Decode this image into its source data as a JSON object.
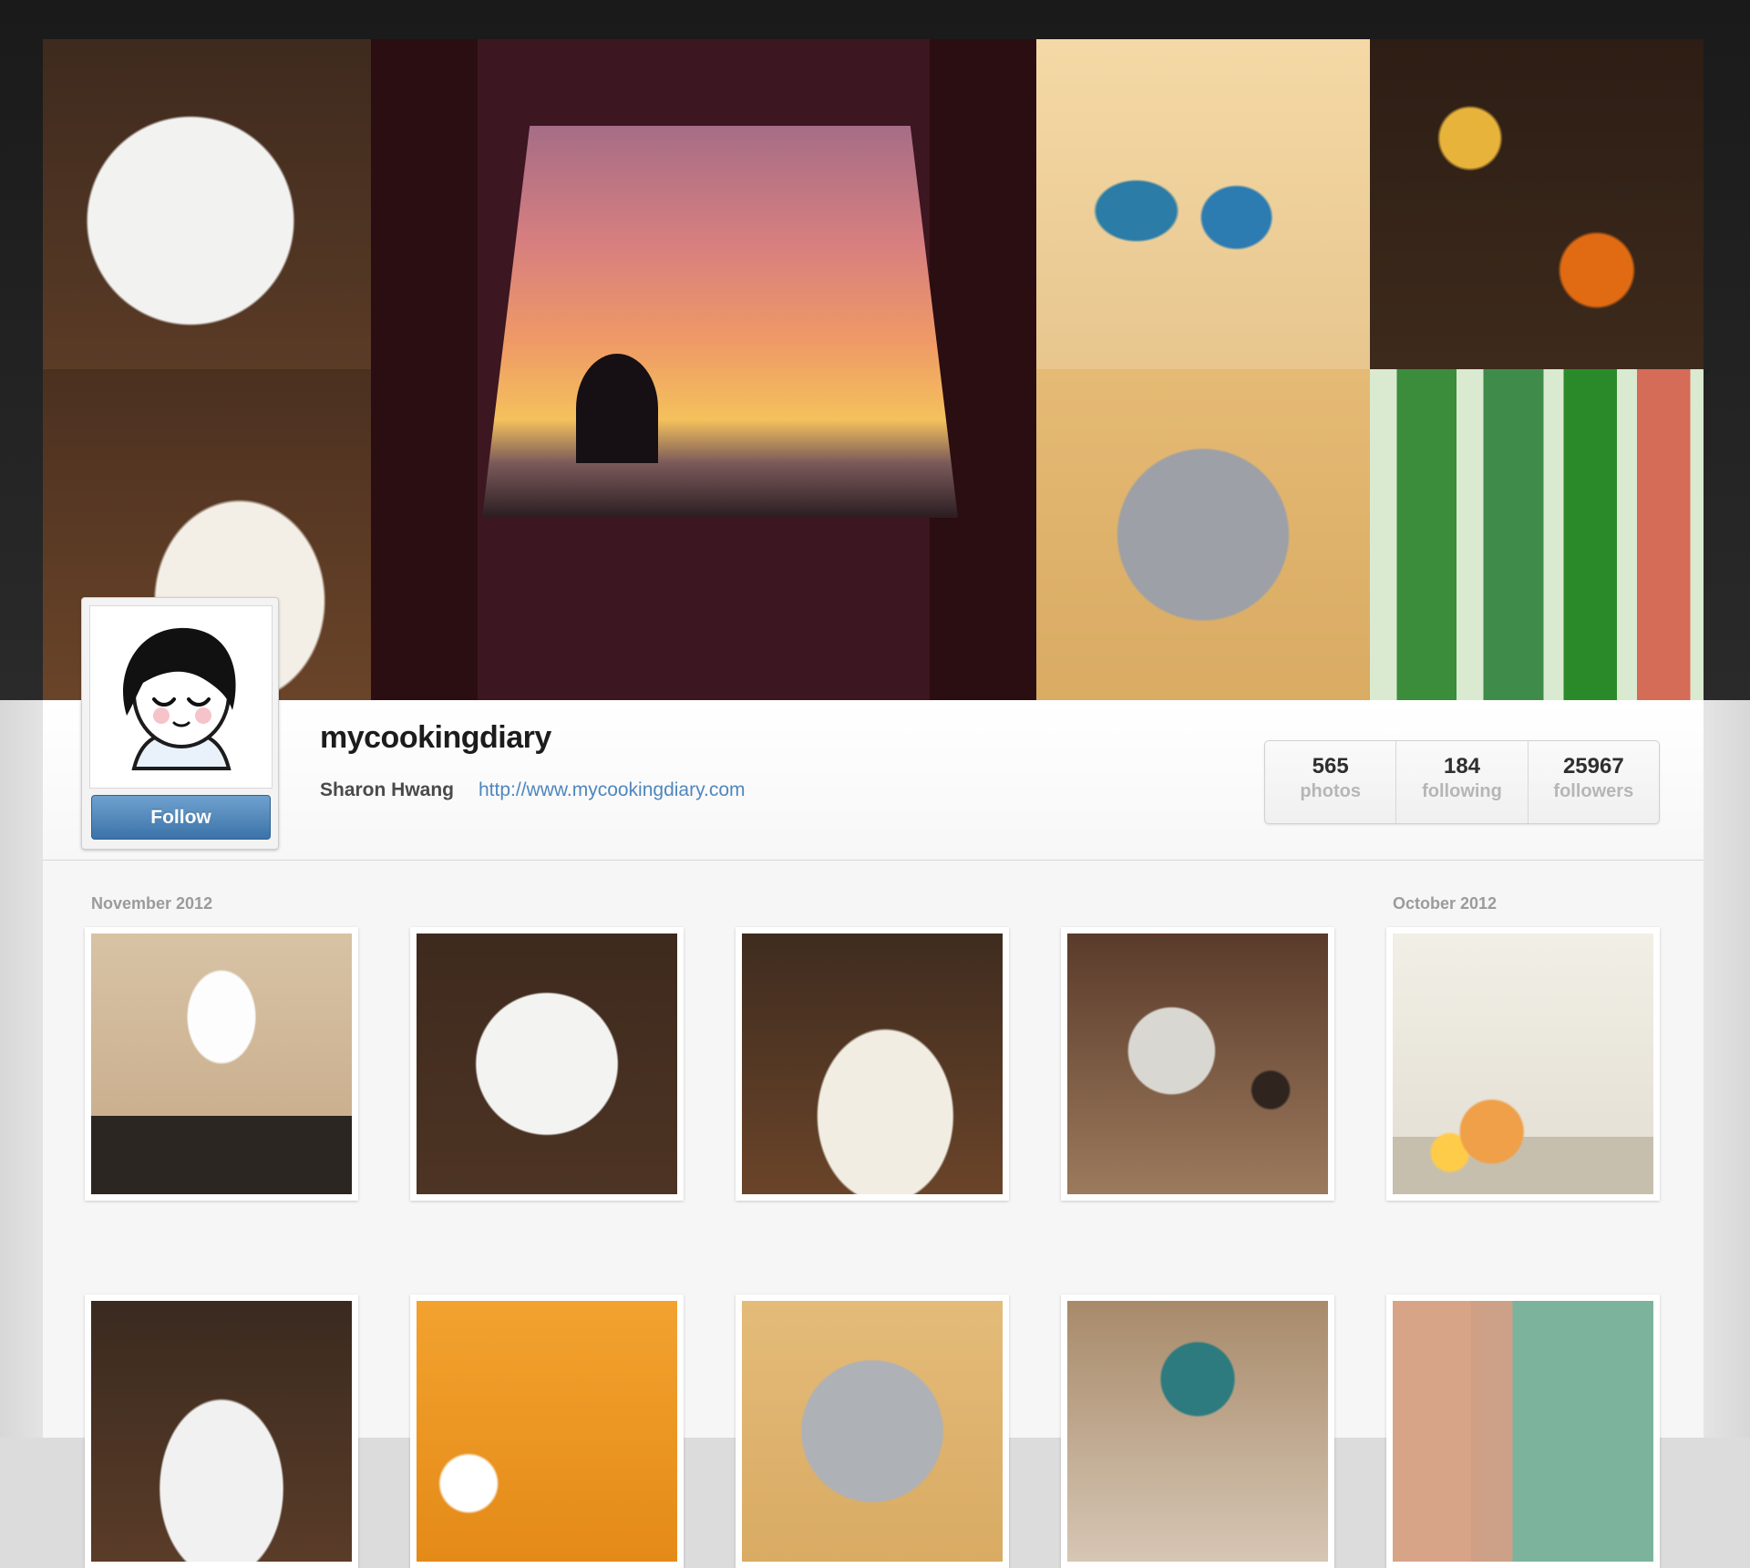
{
  "profile": {
    "username": "mycookingdiary",
    "full_name": "Sharon Hwang",
    "website": "http://www.mycookingdiary.com",
    "follow_label": "Follow"
  },
  "stats": [
    {
      "count": "565",
      "label": "photos"
    },
    {
      "count": "184",
      "label": "following"
    },
    {
      "count": "25967",
      "label": "followers"
    }
  ],
  "sections": [
    {
      "label": "November 2012"
    },
    {
      "label": "October 2012"
    }
  ],
  "colors": {
    "follow_button": "#3b73a8",
    "link": "#4f86bd",
    "stat_label": "#b6b6b6"
  }
}
